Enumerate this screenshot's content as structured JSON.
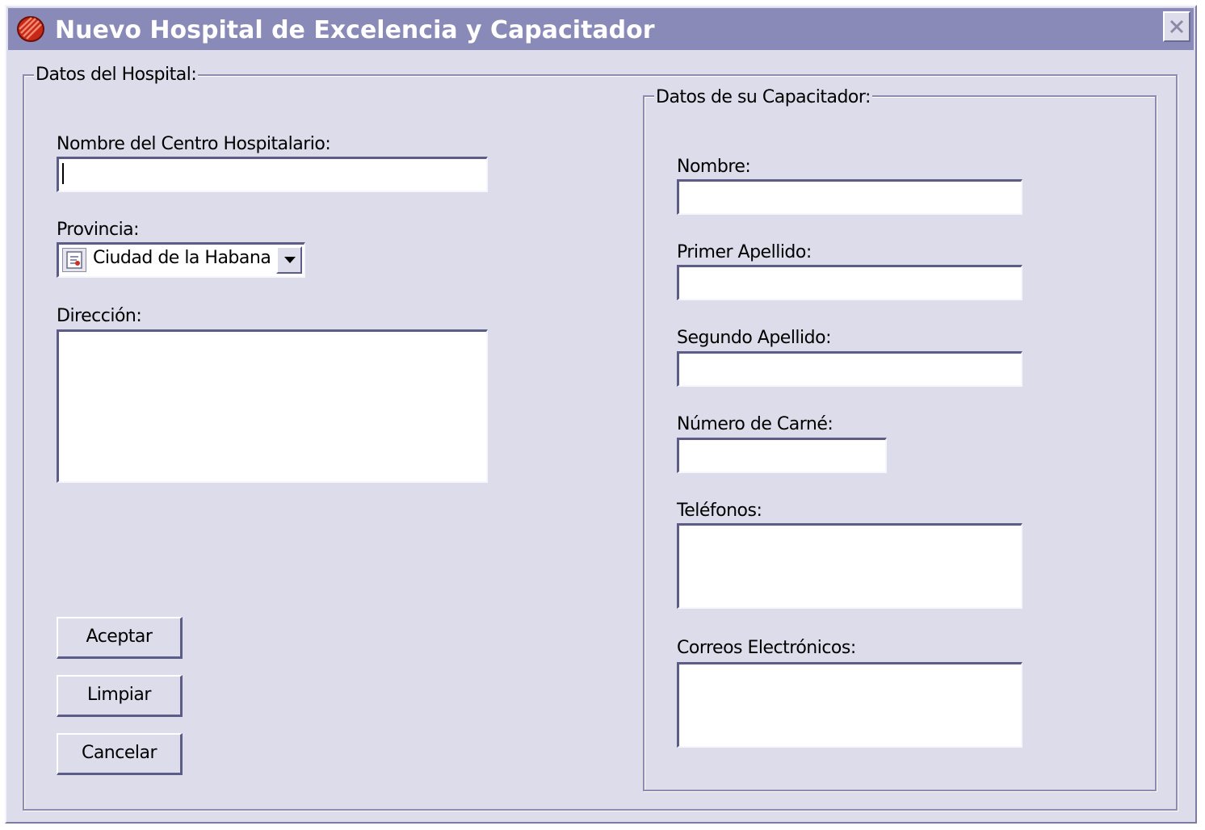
{
  "window": {
    "title": "Nuevo Hospital de Excelencia y Capacitador",
    "icon": "hospital-logo-icon",
    "close_icon": "close-icon"
  },
  "hospital_group": {
    "legend": "Datos del Hospital:",
    "nombre_label": "Nombre del Centro Hospitalario:",
    "nombre_value": "",
    "provincia_label": "Provincia:",
    "provincia_selected": "Ciudad de la Habana",
    "provincia_icon": "map-icon",
    "direccion_label": "Dirección:",
    "direccion_value": ""
  },
  "buttons": {
    "aceptar": "Aceptar",
    "limpiar": "Limpiar",
    "cancelar": "Cancelar"
  },
  "capacitador_group": {
    "legend": "Datos de su Capacitador:",
    "nombre_label": "Nombre:",
    "primer_apellido_label": "Primer Apellido:",
    "segundo_apellido_label": "Segundo Apellido:",
    "carne_label": "Número de Carné:",
    "telefonos_label": "Teléfonos:",
    "correos_label": "Correos Electrónicos:"
  },
  "colors": {
    "titlebar": "#8a8ab8",
    "window_bg": "#dcdcea",
    "icon_red": "#d03020"
  }
}
